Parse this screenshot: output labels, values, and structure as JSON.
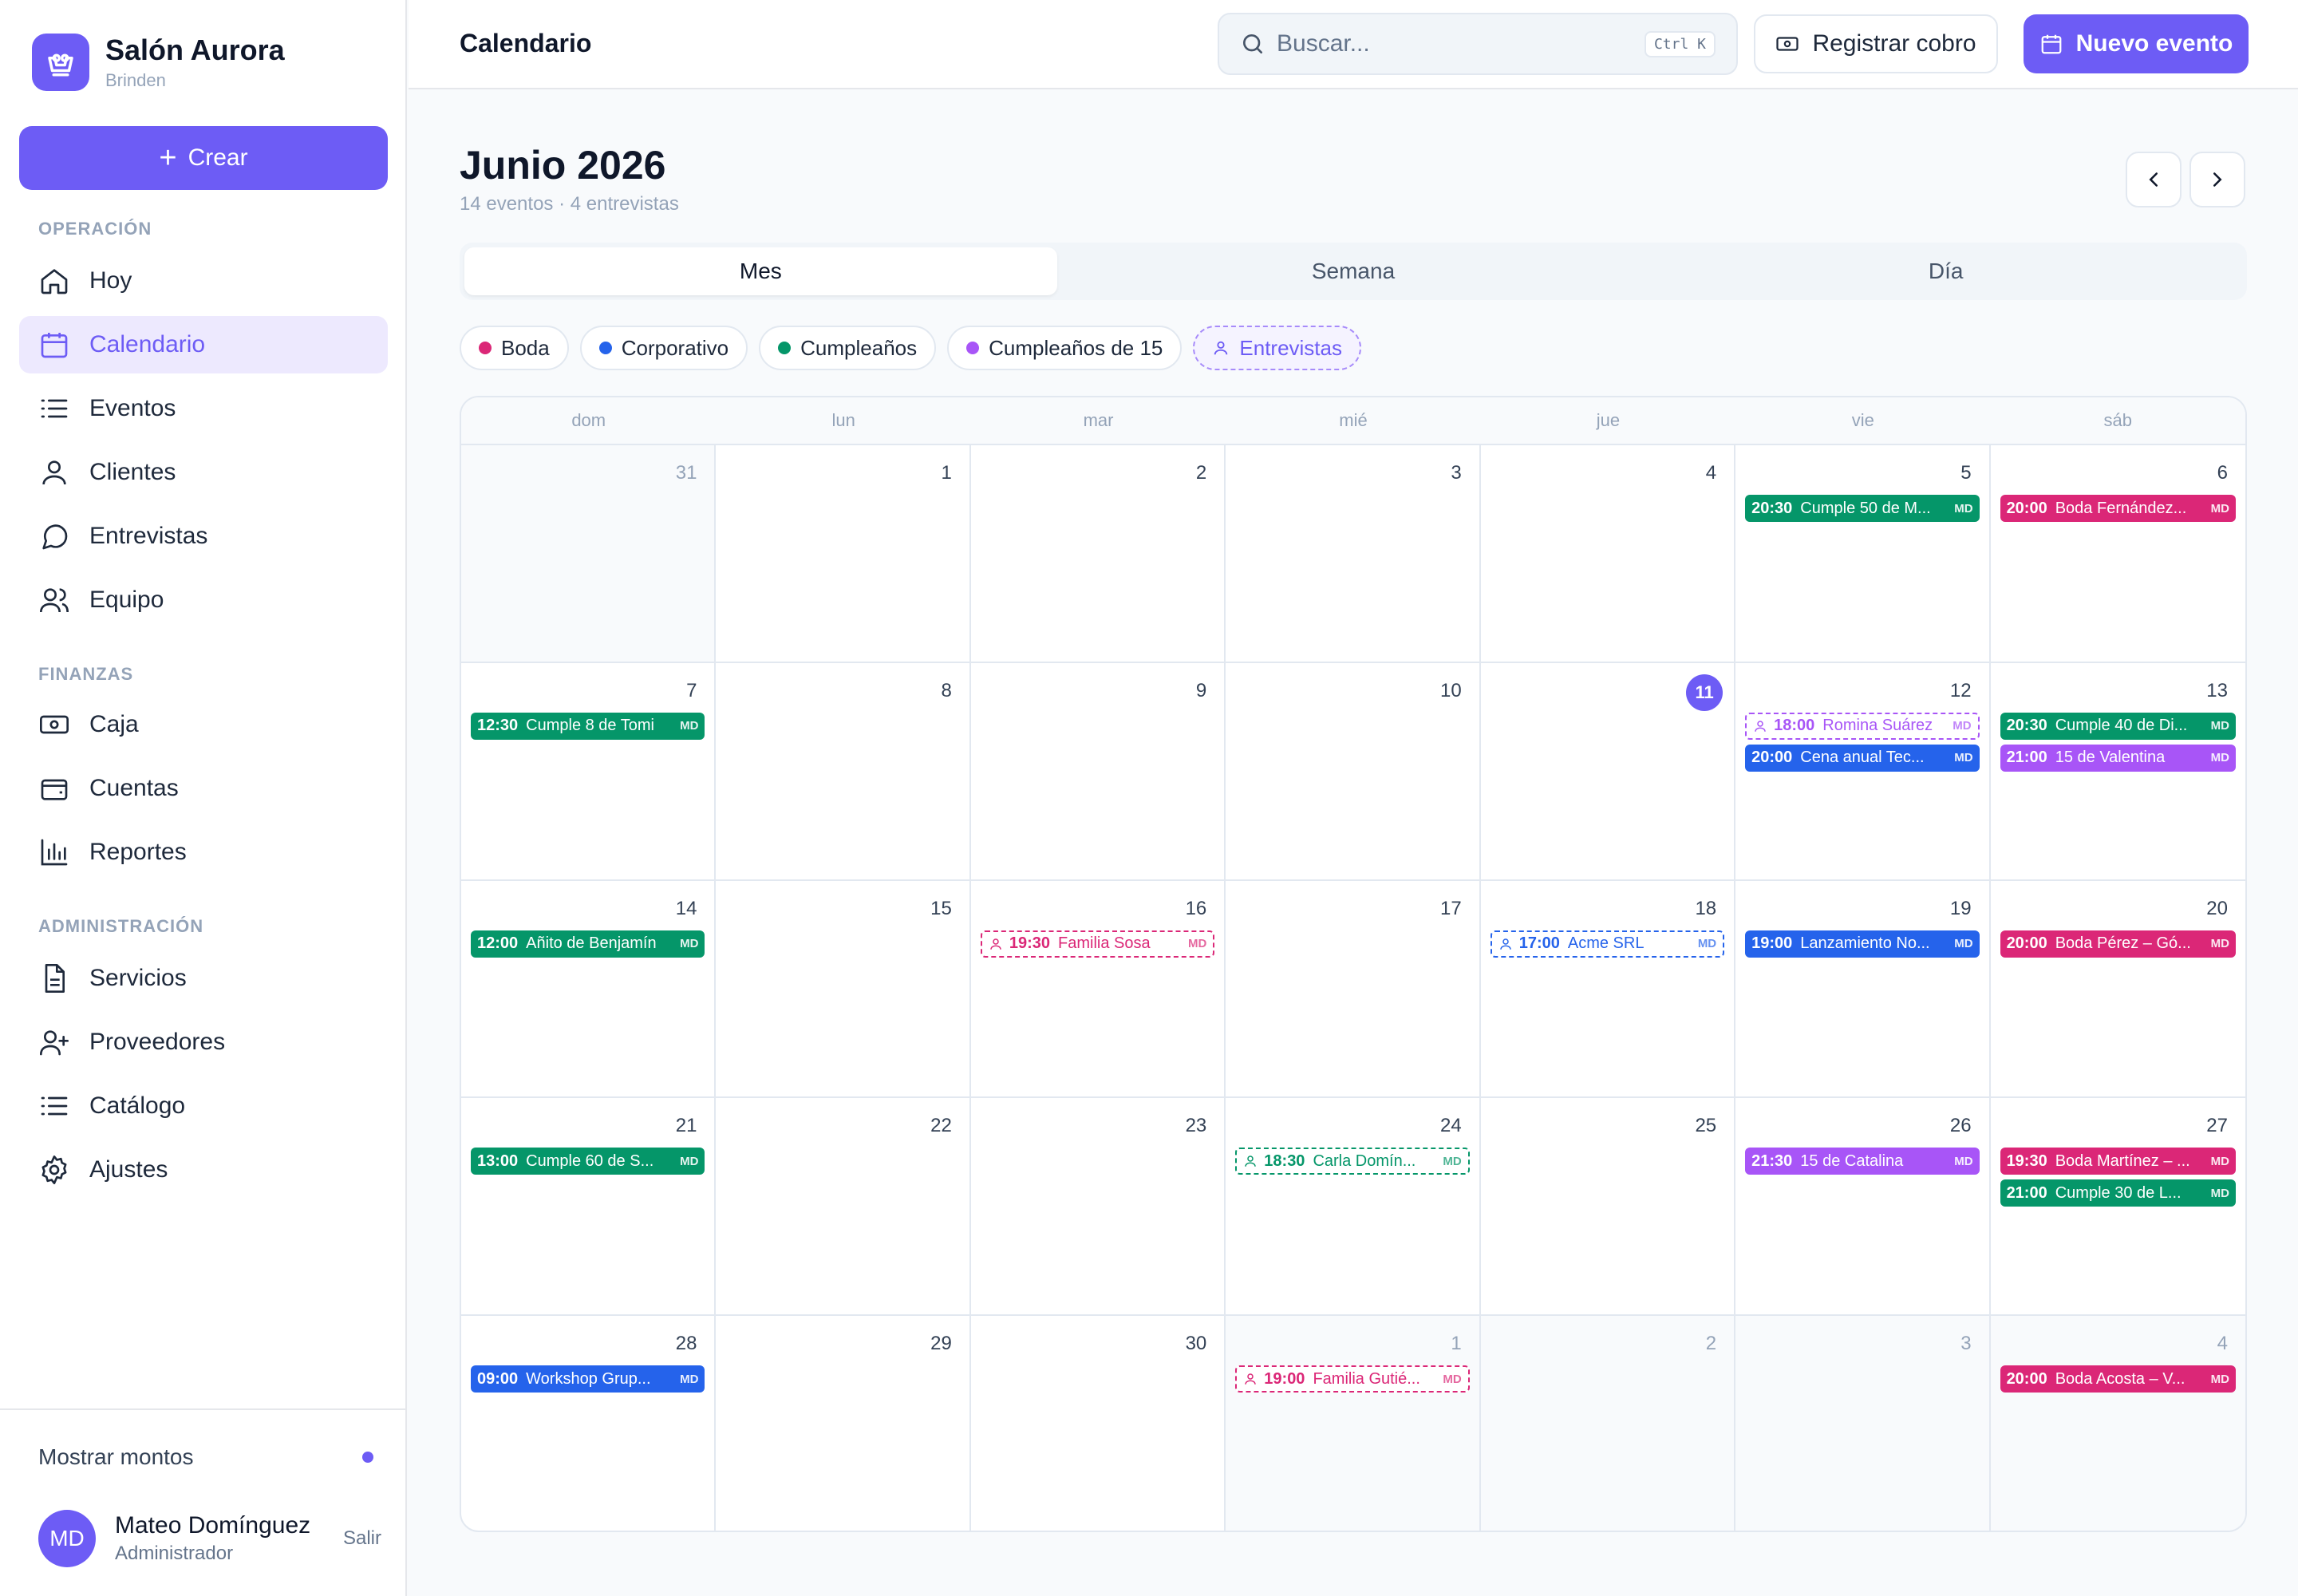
{
  "app": {
    "name": "Salón Aurora",
    "subtitle": "Brinden",
    "create_label": "Crear"
  },
  "colors": {
    "accent": "#6d5cf5",
    "boda": "#db2777",
    "corporativo": "#2563eb",
    "cumpleanos": "#059669",
    "cumple15": "#a855f7"
  },
  "sidebar": {
    "sections": [
      "OPERACIÓN",
      "FINANZAS",
      "ADMINISTRACIÓN"
    ],
    "items": [
      {
        "label": "Hoy",
        "icon": "home-icon"
      },
      {
        "label": "Calendario",
        "icon": "calendar-icon",
        "active": true
      },
      {
        "label": "Eventos",
        "icon": "list-icon"
      },
      {
        "label": "Clientes",
        "icon": "user-icon"
      },
      {
        "label": "Entrevistas",
        "icon": "chat-icon"
      },
      {
        "label": "Equipo",
        "icon": "users-icon"
      },
      {
        "label": "Caja",
        "icon": "cash-icon"
      },
      {
        "label": "Cuentas",
        "icon": "wallet-icon"
      },
      {
        "label": "Reportes",
        "icon": "bar-chart-icon"
      },
      {
        "label": "Servicios",
        "icon": "document-icon"
      },
      {
        "label": "Proveedores",
        "icon": "user-plus-icon"
      },
      {
        "label": "Catálogo",
        "icon": "list-icon"
      },
      {
        "label": "Ajustes",
        "icon": "gear-icon"
      }
    ],
    "toggle_label": "Mostrar montos",
    "user": {
      "initials": "MD",
      "name": "Mateo Domínguez",
      "role": "Administrador",
      "logout": "Salir"
    }
  },
  "topbar": {
    "title": "Calendario",
    "search_placeholder": "Buscar...",
    "search_shortcut": "Ctrl K",
    "register_label": "Registrar cobro",
    "new_event_label": "Nuevo evento"
  },
  "calendar": {
    "title": "Junio 2026",
    "summary": "14 eventos · 4 entrevistas",
    "views": [
      "Mes",
      "Semana",
      "Día"
    ],
    "active_view": "Mes",
    "filters": [
      {
        "label": "Boda",
        "color": "#db2777"
      },
      {
        "label": "Corporativo",
        "color": "#2563eb"
      },
      {
        "label": "Cumpleaños",
        "color": "#059669"
      },
      {
        "label": "Cumpleaños de 15",
        "color": "#a855f7"
      },
      {
        "label": "Entrevistas",
        "dashed": true
      }
    ],
    "weekdays": [
      "dom",
      "lun",
      "mar",
      "mié",
      "jue",
      "vie",
      "sáb"
    ],
    "today": "11",
    "days": [
      {
        "n": "31",
        "other": true,
        "events": []
      },
      {
        "n": "1",
        "events": []
      },
      {
        "n": "2",
        "events": []
      },
      {
        "n": "3",
        "events": []
      },
      {
        "n": "4",
        "events": []
      },
      {
        "n": "5",
        "events": [
          {
            "time": "20:30",
            "name": "Cumple 50 de M...",
            "kind": "cumpleanos",
            "initials": "MD"
          }
        ]
      },
      {
        "n": "6",
        "events": [
          {
            "time": "20:00",
            "name": "Boda Fernández...",
            "kind": "boda",
            "initials": "MD"
          }
        ]
      },
      {
        "n": "7",
        "events": [
          {
            "time": "12:30",
            "name": "Cumple 8 de Tomi",
            "kind": "cumpleanos",
            "initials": "MD"
          }
        ]
      },
      {
        "n": "8",
        "events": []
      },
      {
        "n": "9",
        "events": []
      },
      {
        "n": "10",
        "events": []
      },
      {
        "n": "11",
        "today": true,
        "events": []
      },
      {
        "n": "12",
        "events": [
          {
            "time": "18:00",
            "name": "Romina Suárez",
            "kind": "cumple15",
            "interview": true,
            "initials": "MD"
          },
          {
            "time": "20:00",
            "name": "Cena anual Tec...",
            "kind": "corporativo",
            "initials": "MD"
          }
        ]
      },
      {
        "n": "13",
        "events": [
          {
            "time": "20:30",
            "name": "Cumple 40 de Di...",
            "kind": "cumpleanos",
            "initials": "MD"
          },
          {
            "time": "21:00",
            "name": "15 de Valentina",
            "kind": "cumple15",
            "initials": "MD"
          }
        ]
      },
      {
        "n": "14",
        "events": [
          {
            "time": "12:00",
            "name": "Añito de Benjamín",
            "kind": "cumpleanos",
            "initials": "MD"
          }
        ]
      },
      {
        "n": "15",
        "events": []
      },
      {
        "n": "16",
        "events": [
          {
            "time": "19:30",
            "name": "Familia Sosa",
            "kind": "boda",
            "interview": true,
            "initials": "MD"
          }
        ]
      },
      {
        "n": "17",
        "events": []
      },
      {
        "n": "18",
        "events": [
          {
            "time": "17:00",
            "name": "Acme SRL",
            "kind": "corporativo",
            "interview": true,
            "initials": "MD"
          }
        ]
      },
      {
        "n": "19",
        "events": [
          {
            "time": "19:00",
            "name": "Lanzamiento No...",
            "kind": "corporativo",
            "initials": "MD"
          }
        ]
      },
      {
        "n": "20",
        "events": [
          {
            "time": "20:00",
            "name": "Boda Pérez – Gó...",
            "kind": "boda",
            "initials": "MD"
          }
        ]
      },
      {
        "n": "21",
        "events": [
          {
            "time": "13:00",
            "name": "Cumple 60 de S...",
            "kind": "cumpleanos",
            "initials": "MD"
          }
        ]
      },
      {
        "n": "22",
        "events": []
      },
      {
        "n": "23",
        "events": []
      },
      {
        "n": "24",
        "events": [
          {
            "time": "18:30",
            "name": "Carla Domín...",
            "kind": "cumpleanos",
            "interview": true,
            "initials": "MD"
          }
        ]
      },
      {
        "n": "25",
        "events": []
      },
      {
        "n": "26",
        "events": [
          {
            "time": "21:30",
            "name": "15 de Catalina",
            "kind": "cumple15",
            "initials": "MD"
          }
        ]
      },
      {
        "n": "27",
        "events": [
          {
            "time": "19:30",
            "name": "Boda Martínez – ...",
            "kind": "boda",
            "initials": "MD"
          },
          {
            "time": "21:00",
            "name": "Cumple 30 de L...",
            "kind": "cumpleanos",
            "initials": "MD"
          }
        ]
      },
      {
        "n": "28",
        "events": [
          {
            "time": "09:00",
            "name": "Workshop Grup...",
            "kind": "corporativo",
            "initials": "MD"
          }
        ]
      },
      {
        "n": "29",
        "events": []
      },
      {
        "n": "30",
        "events": []
      },
      {
        "n": "1",
        "other": true,
        "events": [
          {
            "time": "19:00",
            "name": "Familia Gutié...",
            "kind": "boda",
            "interview": true,
            "initials": "MD"
          }
        ]
      },
      {
        "n": "2",
        "other": true,
        "events": []
      },
      {
        "n": "3",
        "other": true,
        "events": []
      },
      {
        "n": "4",
        "other": true,
        "events": [
          {
            "time": "20:00",
            "name": "Boda Acosta – V...",
            "kind": "boda",
            "initials": "MD"
          }
        ]
      }
    ]
  }
}
